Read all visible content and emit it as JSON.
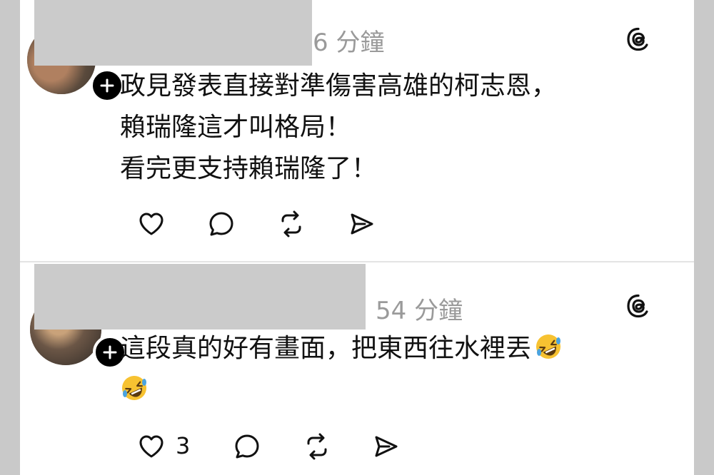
{
  "posts": [
    {
      "time": "6 分鐘",
      "lines": [
        "政見發表直接對準傷害高雄的柯志恩，",
        "賴瑞隆這才叫格局！",
        "看完更支持賴瑞隆了！"
      ],
      "like_count": ""
    },
    {
      "time": "54 分鐘",
      "lines": [
        "這段真的好有畫面，把東西往水裡丟",
        ""
      ],
      "emoji": "rolling-on-the-floor-laughing",
      "like_count": "3"
    }
  ],
  "icons": {
    "follow": "plus-icon",
    "app": "threads-icon",
    "like": "heart-icon",
    "reply": "comment-icon",
    "repost": "repost-icon",
    "share": "send-icon"
  },
  "colors": {
    "background": "#c9c9c9",
    "card": "#ffffff",
    "text": "#111111",
    "muted": "#9a9a9a",
    "redaction": "#cbcbcb",
    "emoji": "#f7c231"
  }
}
